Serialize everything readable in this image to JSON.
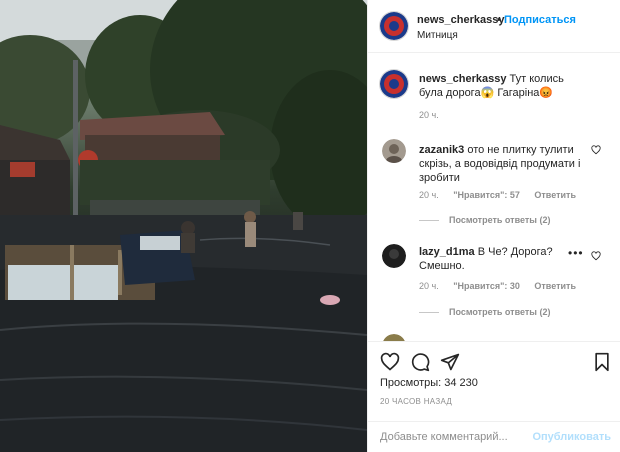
{
  "post": {
    "username": "news_cherkassy",
    "dot": "•",
    "follow_label": "Подписаться",
    "location": "Митниця"
  },
  "caption": {
    "username": "news_cherkassy",
    "text": "Тут колись була дорога😱 Гагаріна😡",
    "time": "20 ч."
  },
  "comments": [
    {
      "username": "zazanik3",
      "text": "ото не плитку тулити скрізь, а водовідвід продумати і зробити",
      "time": "20 ч.",
      "likes": "\"Нравится\": 57",
      "reply": "Ответить",
      "view_replies": "Посмотреть ответы (2)"
    },
    {
      "username": "lazy_d1ma",
      "text": "В Че? Дорога? Смешно.",
      "time": "20 ч.",
      "likes": "\"Нравится\": 30",
      "reply": "Ответить",
      "view_replies": "Посмотреть ответы (2)"
    }
  ],
  "stats": {
    "views_label": "Просмотры: 34 230",
    "time_ago": "20 ЧАСОВ НАЗАД"
  },
  "comment_box": {
    "placeholder": "Добавьте комментарий...",
    "publish_label": "Опубликовать"
  },
  "colors": {
    "accent": "#0095f6",
    "publish_disabled": "#b2dffc",
    "text": "#262626",
    "muted": "#8e8e8e"
  },
  "icons": [
    "heart-icon",
    "comment-icon",
    "share-icon",
    "bookmark-icon",
    "more-icon"
  ]
}
